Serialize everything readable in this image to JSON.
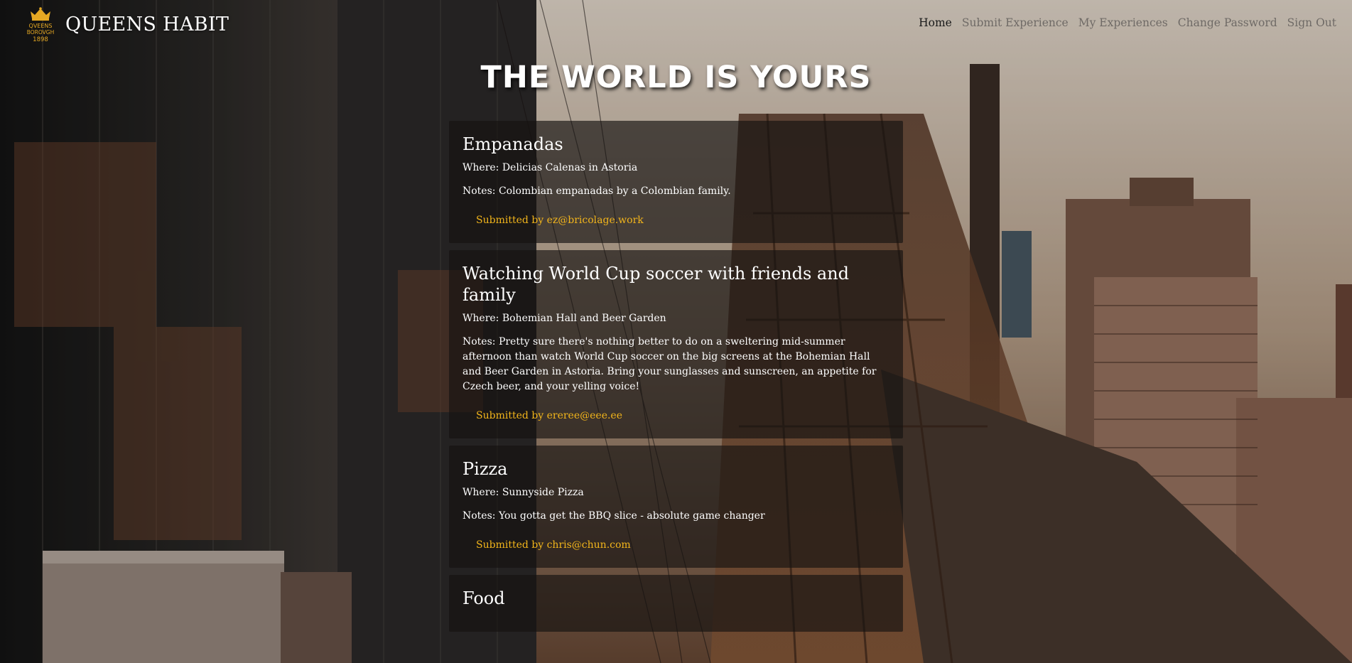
{
  "brand": {
    "name": "QUEENS HABIT",
    "logo_text_1": "QVEENS",
    "logo_text_2": "BOROVGH",
    "logo_text_3": "1898",
    "logo_color": "#e5a823"
  },
  "nav": {
    "items": [
      {
        "label": "Home",
        "active": true
      },
      {
        "label": "Submit Experience",
        "active": false
      },
      {
        "label": "My Experiences",
        "active": false
      },
      {
        "label": "Change Password",
        "active": false
      },
      {
        "label": "Sign Out",
        "active": false
      }
    ]
  },
  "hero": {
    "title": "THE WORLD IS YOURS"
  },
  "experiences": [
    {
      "title": "Empanadas",
      "where": "Where: Delicias Calenas in Astoria",
      "notes": "Notes: Colombian empanadas by a Colombian family.",
      "submitted": "Submitted by ez@bricolage.work"
    },
    {
      "title": "Watching World Cup soccer with friends and family",
      "where": "Where: Bohemian Hall and Beer Garden",
      "notes": "Notes: Pretty sure there's nothing better to do on a sweltering mid-summer afternoon than watch World Cup soccer on the big screens at the Bohemian Hall and Beer Garden in Astoria. Bring your sunglasses and sunscreen, an appetite for Czech beer, and your yelling voice!",
      "submitted": "Submitted by ereree@eee.ee"
    },
    {
      "title": "Pizza",
      "where": "Where: Sunnyside Pizza",
      "notes": "Notes: You gotta get the BBQ slice - absolute game changer",
      "submitted": "Submitted by chris@chun.com"
    },
    {
      "title": "Food"
    }
  ],
  "colors": {
    "accent": "#f2b51b",
    "nav_active": "#1a1a1a",
    "nav_inactive": "#6f6a66",
    "card_bg": "rgba(22,18,16,0.66)"
  }
}
